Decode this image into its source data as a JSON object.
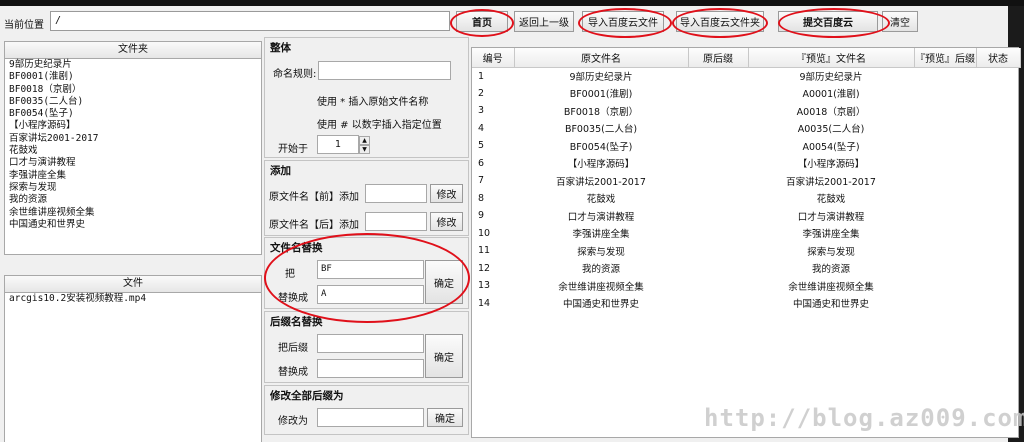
{
  "pathbar": {
    "label": "当前位置",
    "path_value": "/",
    "buttons": {
      "home": "首页",
      "up": "返回上一级",
      "import_file": "导入百度云文件",
      "import_folder": "导入百度云文件夹",
      "submit": "提交百度云",
      "clear": "清空"
    }
  },
  "folders": {
    "header": "文件夹",
    "items": [
      "9部历史纪录片",
      "BF0001(淮剧)",
      "BF0018（京剧）",
      "BF0035(二人台)",
      "BF0054(坠子)",
      "【小程序源码】",
      "百家讲坛2001-2017",
      "花鼓戏",
      "口才与演讲教程",
      "李强讲座全集",
      "探索与发现",
      "我的资源",
      "余世维讲座视频全集",
      "中国通史和世界史"
    ]
  },
  "files": {
    "header": "文件",
    "items": [
      "arcgis10.2安装视频教程.mp4"
    ]
  },
  "overall": {
    "title": "整体",
    "naming_rule_label": "命名规则:",
    "naming_rule_value": "",
    "hint1": "使用 * 插入原始文件名称",
    "hint2": "使用 # 以数字插入指定位置",
    "start_label": "开始于",
    "start_value": "1"
  },
  "add": {
    "title": "添加",
    "before_label": "原文件名【前】添加",
    "before_value": "",
    "before_btn": "修改",
    "after_label": "原文件名【后】添加",
    "after_value": "",
    "after_btn": "修改"
  },
  "replace_name": {
    "title": "文件名替换",
    "from_label": "把",
    "from_value": "BF",
    "to_label": "替换成",
    "to_value": "A",
    "btn": "确定"
  },
  "replace_ext": {
    "title": "后缀名替换",
    "from_label": "把后缀",
    "from_value": "",
    "to_label": "替换成",
    "to_value": "",
    "btn": "确定"
  },
  "change_all_ext": {
    "title": "修改全部后缀为",
    "label": "修改为",
    "value": "",
    "btn": "确定"
  },
  "table": {
    "headers": [
      "编号",
      "原文件名",
      "原后缀",
      "『预览』文件名",
      "『预览』后缀",
      "状态"
    ],
    "rows": [
      [
        "1",
        "9部历史纪录片",
        "",
        "9部历史纪录片",
        "",
        ""
      ],
      [
        "2",
        "BF0001(淮剧)",
        "",
        "A0001(淮剧)",
        "",
        ""
      ],
      [
        "3",
        "BF0018（京剧）",
        "",
        "A0018（京剧）",
        "",
        ""
      ],
      [
        "4",
        "BF0035(二人台)",
        "",
        "A0035(二人台)",
        "",
        ""
      ],
      [
        "5",
        "BF0054(坠子)",
        "",
        "A0054(坠子)",
        "",
        ""
      ],
      [
        "6",
        "【小程序源码】",
        "",
        "【小程序源码】",
        "",
        ""
      ],
      [
        "7",
        "百家讲坛2001-2017",
        "",
        "百家讲坛2001-2017",
        "",
        ""
      ],
      [
        "8",
        "花鼓戏",
        "",
        "花鼓戏",
        "",
        ""
      ],
      [
        "9",
        "口才与演讲教程",
        "",
        "口才与演讲教程",
        "",
        ""
      ],
      [
        "10",
        "李强讲座全集",
        "",
        "李强讲座全集",
        "",
        ""
      ],
      [
        "11",
        "探索与发现",
        "",
        "探索与发现",
        "",
        ""
      ],
      [
        "12",
        "我的资源",
        "",
        "我的资源",
        "",
        ""
      ],
      [
        "13",
        "余世维讲座视频全集",
        "",
        "余世维讲座视频全集",
        "",
        ""
      ],
      [
        "14",
        "中国通史和世界史",
        "",
        "中国通史和世界史",
        "",
        ""
      ]
    ]
  },
  "watermark": "http://blog.az009.com",
  "colors": {
    "highlight": "#e0101a",
    "window_bg": "#f0f0f0"
  }
}
